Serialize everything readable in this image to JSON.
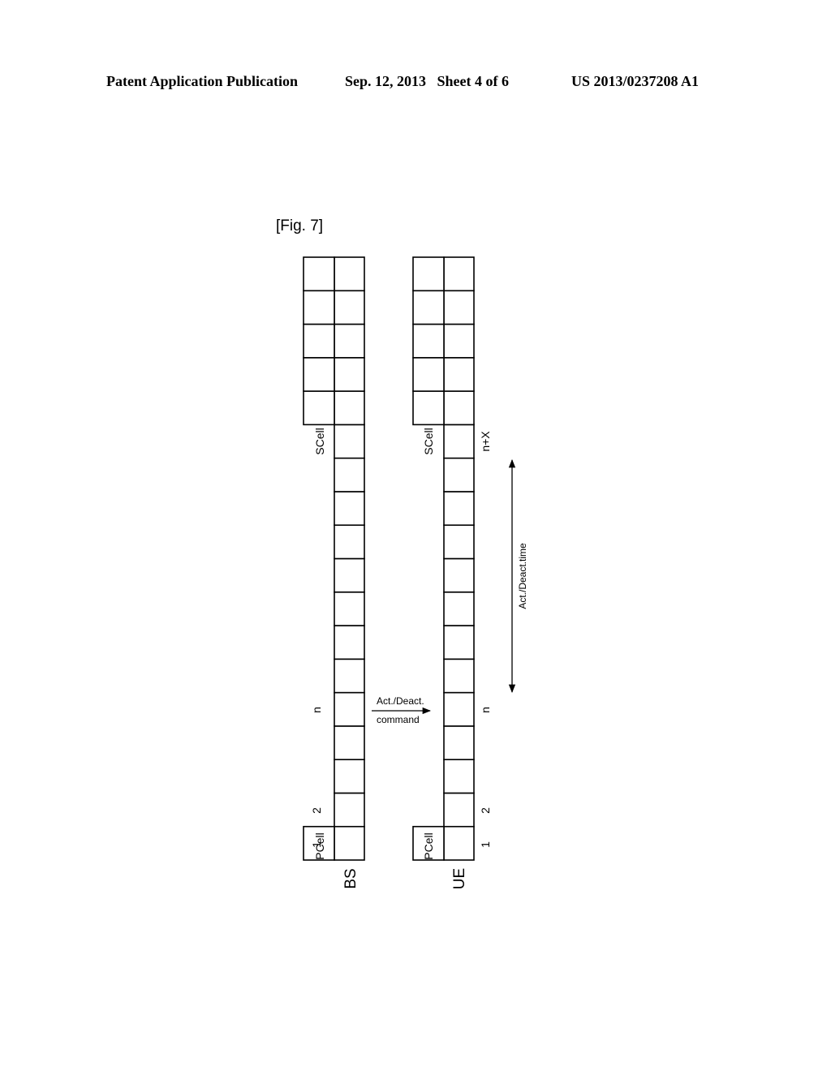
{
  "header": {
    "left": "Patent Application Publication",
    "middle": "Sep. 12, 2013   Sheet 4 of 6",
    "right": "US 2013/0237208 A1"
  },
  "figure": {
    "label": "[Fig. 7]",
    "total_subframes": 18,
    "scell_row_index": 13,
    "n_row_index": 5,
    "bs": {
      "name": "BS",
      "pcell_label": "PCell",
      "scell_label": "SCell",
      "index_labels": {
        "first": "1",
        "second": "2",
        "n": "n"
      }
    },
    "ue": {
      "name": "UE",
      "pcell_label": "PCell",
      "scell_label": "SCell",
      "index_labels": {
        "first": "1",
        "second": "2",
        "n": "n",
        "n_plus_x": "n+X"
      }
    },
    "command_arrow": {
      "line1": "Act./Deact.",
      "line2": "command"
    },
    "time_span": {
      "label": "Act./Deact.time"
    }
  }
}
